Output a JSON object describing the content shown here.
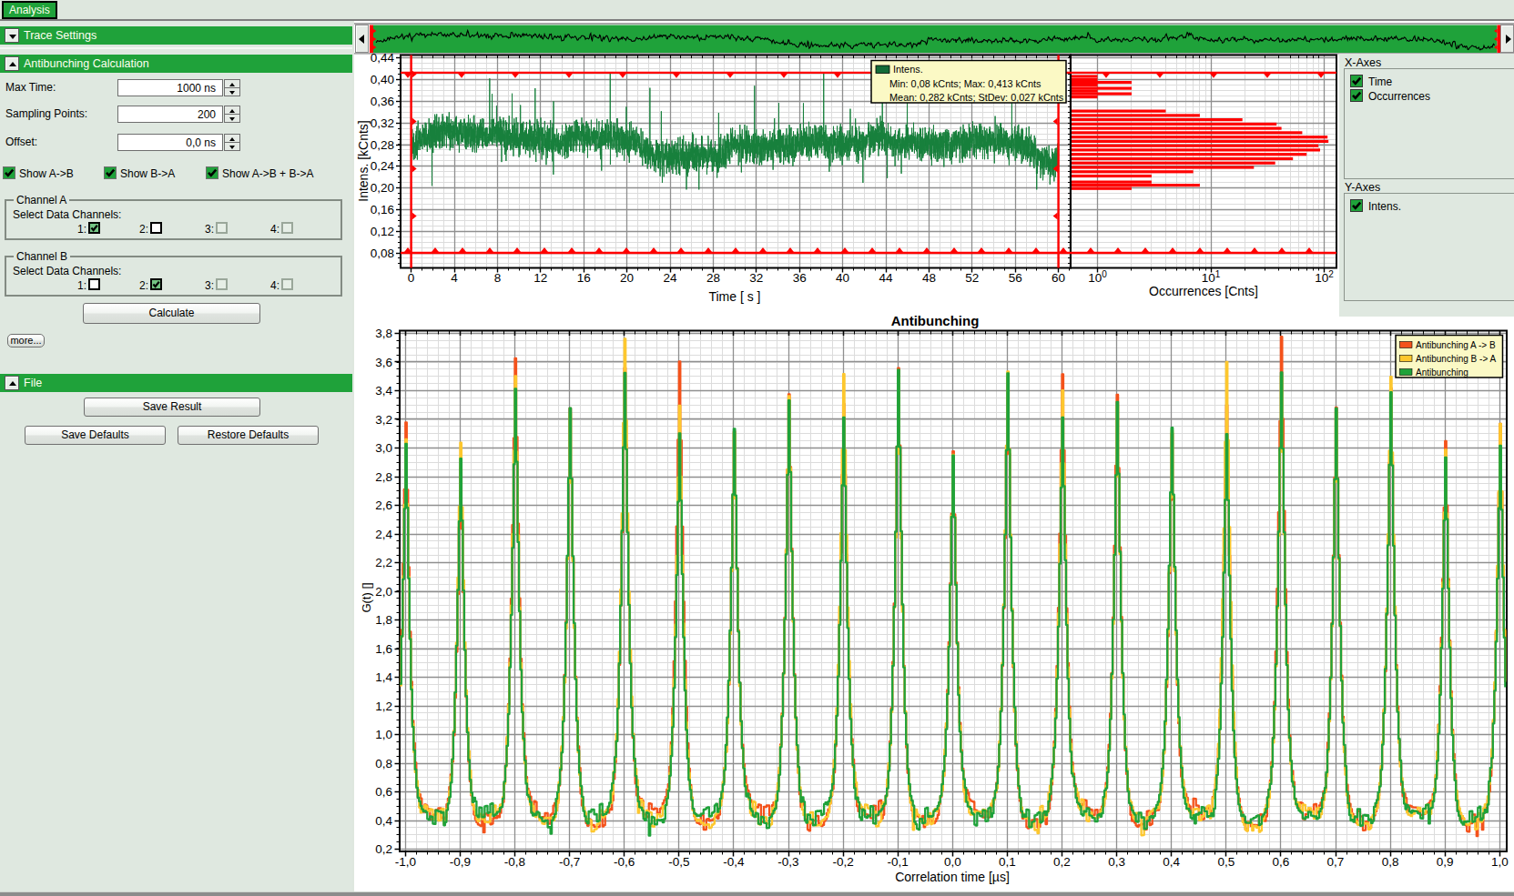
{
  "tabs": {
    "items": [
      {
        "label": "Analysis",
        "active": true
      }
    ]
  },
  "sidebar": {
    "sections": [
      {
        "id": "trace-settings",
        "title": "Trace Settings",
        "collapsed": true
      },
      {
        "id": "antibunching-calculation",
        "title": "Antibunching Calculation",
        "collapsed": false
      },
      {
        "id": "file",
        "title": "File",
        "collapsed": false
      }
    ],
    "fields": [
      {
        "label": "Max Time:",
        "value": "1000 ns"
      },
      {
        "label": "Sampling Points:",
        "value": "200"
      },
      {
        "label": "Offset:",
        "value": "0,0 ns"
      }
    ],
    "show_checkboxes": [
      {
        "label": "Show A->B",
        "checked": true
      },
      {
        "label": "Show B->A",
        "checked": true
      },
      {
        "label": "Show A->B + B->A",
        "checked": true
      }
    ],
    "channel_groups": [
      {
        "title": "Channel A",
        "label": "Select Data Channels:",
        "channels": [
          {
            "label": "1:",
            "checked": true,
            "enabled": true
          },
          {
            "label": "2:",
            "checked": false,
            "enabled": true
          },
          {
            "label": "3:",
            "checked": false,
            "enabled": false
          },
          {
            "label": "4:",
            "checked": false,
            "enabled": false
          }
        ]
      },
      {
        "title": "Channel B",
        "label": "Select Data Channels:",
        "channels": [
          {
            "label": "1:",
            "checked": false,
            "enabled": true
          },
          {
            "label": "2:",
            "checked": true,
            "enabled": true
          },
          {
            "label": "3:",
            "checked": false,
            "enabled": false
          },
          {
            "label": "4:",
            "checked": false,
            "enabled": false
          }
        ]
      }
    ],
    "buttons": {
      "calculate": "Calculate",
      "more": "more...",
      "save_result": "Save Result",
      "save_defaults": "Save Defaults",
      "restore_defaults": "Restore Defaults"
    }
  },
  "axes_panel": {
    "x_title": "X-Axes",
    "x_items": [
      {
        "label": "Time",
        "checked": true
      },
      {
        "label": "Occurrences",
        "checked": true
      }
    ],
    "y_title": "Y-Axes",
    "y_items": [
      {
        "label": "Intens.",
        "checked": true
      }
    ]
  },
  "colors": {
    "accent_green": "#1fa23a",
    "cursor_red": "#ff0000",
    "trace_green": "#17803c",
    "series_orange": "#f4521b",
    "series_yellow": "#fdc72e",
    "series_green": "#1fa23a",
    "tooltip_bg": "#fbf9c5",
    "panel_bg": "#dfe8e0"
  },
  "chart_data": [
    {
      "id": "overview",
      "type": "line",
      "description": "Minified intensity trace shown in the top scroll strip",
      "bg": "#1fa23a",
      "line_color": "#000000",
      "source": "intensity_trace"
    },
    {
      "id": "intensity_trace",
      "type": "line",
      "title": "",
      "xlabel": "Time [ s ]",
      "ylabel": "Intens. [kCnts]",
      "xlim": [
        -1.0,
        61.2
      ],
      "ylim": [
        0.052,
        0.4455
      ],
      "xticks": [
        0,
        4,
        8,
        12,
        16,
        20,
        24,
        28,
        32,
        36,
        40,
        44,
        48,
        52,
        56,
        60
      ],
      "yticks": [
        0.08,
        0.12,
        0.16,
        0.2,
        0.24,
        0.28,
        0.32,
        0.36,
        0.4,
        0.44
      ],
      "grid": true,
      "decimal": "comma",
      "series": [
        {
          "name": "Intens.",
          "color": "#17803c",
          "mean_kcnts": 0.282,
          "stdev_kcnts": 0.027,
          "min_kcnts": 0.08,
          "max_kcnts": 0.413
        }
      ],
      "cursors": {
        "x": [
          0,
          60
        ],
        "y": [
          0.08,
          0.413
        ],
        "color": "#ff0000"
      },
      "tooltip": {
        "swatch_color": "#136b38",
        "lines": [
          "Intens.",
          "Min: 0,08 kCnts; Max: 0,413 kCnts",
          "Mean: 0,282 kCnts; StDev: 0,027 kCnts"
        ]
      },
      "baseline_segments": [
        [
          0,
          0.272
        ],
        [
          1.5,
          0.301
        ],
        [
          4,
          0.305
        ],
        [
          6,
          0.295
        ],
        [
          8,
          0.299
        ],
        [
          10,
          0.293
        ],
        [
          12,
          0.289
        ],
        [
          14,
          0.283
        ],
        [
          15,
          0.295
        ],
        [
          17,
          0.293
        ],
        [
          19,
          0.296
        ],
        [
          21,
          0.285
        ],
        [
          21.8,
          0.262
        ],
        [
          23,
          0.257
        ],
        [
          26,
          0.262
        ],
        [
          28,
          0.258
        ],
        [
          29,
          0.262
        ],
        [
          29.8,
          0.283
        ],
        [
          32,
          0.277
        ],
        [
          34,
          0.275
        ],
        [
          36,
          0.281
        ],
        [
          38,
          0.29
        ],
        [
          40,
          0.28
        ],
        [
          42,
          0.287
        ],
        [
          43.5,
          0.296
        ],
        [
          45,
          0.28
        ],
        [
          47,
          0.283
        ],
        [
          49,
          0.281
        ],
        [
          51,
          0.283
        ],
        [
          53,
          0.286
        ],
        [
          55,
          0.284
        ],
        [
          56.5,
          0.282
        ],
        [
          57.5,
          0.268
        ],
        [
          58.7,
          0.248
        ],
        [
          59.6,
          0.24
        ],
        [
          60,
          0.252
        ]
      ],
      "noise_sigma": 0.0155,
      "spike_prob": 0.006,
      "samples": 4500,
      "seed": 1234
    },
    {
      "id": "histogram",
      "type": "bar",
      "orientation": "horizontal",
      "title": "",
      "xlabel": "Occurrences [Cnts]",
      "ylabel": "",
      "xscale": "log",
      "xlim": [
        0.575,
        127
      ],
      "xticks": [
        1,
        10,
        100
      ],
      "bar_color": "#ff0000",
      "bin_width_kcnts": 0.008,
      "model": {
        "mean_kcnts": 0.282,
        "sigma_kcnts": 0.0235,
        "peak_counts": 105,
        "jitter_seed": 7,
        "extra_bins": [
          [
            0.199,
            2
          ],
          [
            0.205,
            8
          ],
          [
            0.211,
            3
          ],
          [
            0.368,
            1
          ],
          [
            0.374,
            2
          ],
          [
            0.379,
            1
          ],
          [
            0.384,
            2
          ],
          [
            0.39,
            1
          ],
          [
            0.395,
            2
          ],
          [
            0.4,
            1
          ],
          [
            0.406,
            1
          ]
        ]
      },
      "description": "Histogram of intensity occurrences, peak about 100 counts at 0.28 kCnts"
    },
    {
      "id": "antibunching",
      "type": "line",
      "title": "Antibunching",
      "xlabel": "Correlation time [µs]",
      "ylabel": "G(t) []",
      "xlim": [
        -1.012,
        1.01
      ],
      "ylim": [
        0.184,
        3.82
      ],
      "xticks": [
        -1.0,
        -0.9,
        -0.8,
        -0.7,
        -0.6,
        -0.5,
        -0.4,
        -0.3,
        -0.2,
        -0.1,
        0.0,
        0.1,
        0.2,
        0.3,
        0.4,
        0.5,
        0.6,
        0.7,
        0.8,
        0.9,
        1.0
      ],
      "yticks": [
        0.2,
        0.4,
        0.6,
        0.8,
        1.0,
        1.2,
        1.4,
        1.6,
        1.8,
        2.0,
        2.2,
        2.4,
        2.6,
        2.8,
        3.0,
        3.2,
        3.4,
        3.6,
        3.8
      ],
      "grid": true,
      "decimal": "comma",
      "legend_pos": "top-right",
      "peak_lags_us": [
        -1.0,
        -0.9,
        -0.8,
        -0.7,
        -0.6,
        -0.5,
        -0.4,
        -0.3,
        -0.2,
        -0.1,
        0.0,
        0.1,
        0.2,
        0.3,
        0.4,
        0.5,
        0.6,
        0.7,
        0.8,
        0.9,
        1.0
      ],
      "baseline": 0.42,
      "peak_width_us": 0.0095,
      "noise": 0.055,
      "series": [
        {
          "name": "Antibunching A -> B",
          "color": "#f4521b",
          "seed": 101,
          "peak_heights": [
            3.17,
            2.87,
            3.62,
            3.28,
            3.55,
            3.61,
            3.12,
            3.37,
            3.3,
            3.56,
            2.98,
            3.5,
            3.51,
            3.38,
            3.1,
            3.3,
            3.77,
            3.29,
            3.42,
            3.04,
            3.17
          ]
        },
        {
          "name": "Antibunching B -> A",
          "color": "#fdc72e",
          "seed": 202,
          "peak_heights": [
            3.05,
            3.04,
            3.5,
            3.25,
            3.75,
            3.3,
            3.1,
            3.36,
            3.51,
            3.5,
            2.96,
            3.55,
            3.4,
            3.3,
            3.12,
            3.6,
            3.5,
            3.25,
            3.5,
            3.0,
            3.17
          ]
        },
        {
          "name": "Antibunching",
          "color": "#1fa23a",
          "seed": 303,
          "peak_heights": [
            3.02,
            2.93,
            3.4,
            3.28,
            3.52,
            3.1,
            3.13,
            3.33,
            3.21,
            3.55,
            2.94,
            3.52,
            3.21,
            3.33,
            3.14,
            3.1,
            3.52,
            3.28,
            3.39,
            2.93,
            3.02
          ]
        }
      ]
    }
  ]
}
